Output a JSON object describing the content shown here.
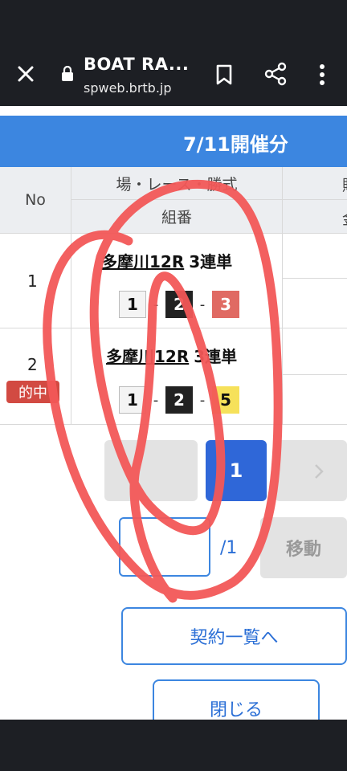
{
  "browser": {
    "title": "BOAT RA...",
    "url": "spweb.brtb.jp",
    "icons": [
      "close-icon",
      "lock-icon",
      "bookmark-icon",
      "share-icon",
      "more-vert-icon"
    ]
  },
  "banner": {
    "title": "7/11開催分"
  },
  "table": {
    "headers": {
      "no": "No",
      "race_col": "場・レース・勝式",
      "combo_col": "組番",
      "next_col_top": "購",
      "next_col_bottom": "金"
    },
    "rows": [
      {
        "no": "1",
        "race": "多摩川12R",
        "bet_type": "3連単",
        "combo": [
          "1",
          "2",
          "3"
        ],
        "badge": ""
      },
      {
        "no": "2",
        "race": "多摩川12R",
        "bet_type": "3連単",
        "combo": [
          "1",
          "2",
          "5"
        ],
        "badge": "的中"
      }
    ]
  },
  "pagination": {
    "current": "1",
    "input_value": "",
    "total": "/1",
    "move": "移動"
  },
  "buttons": {
    "contracts": "契約一覧へ",
    "close": "閉じる"
  },
  "colors": {
    "accent": "#3c86e0",
    "hit_badge": "#d24a42",
    "annotation": "#f25757"
  }
}
